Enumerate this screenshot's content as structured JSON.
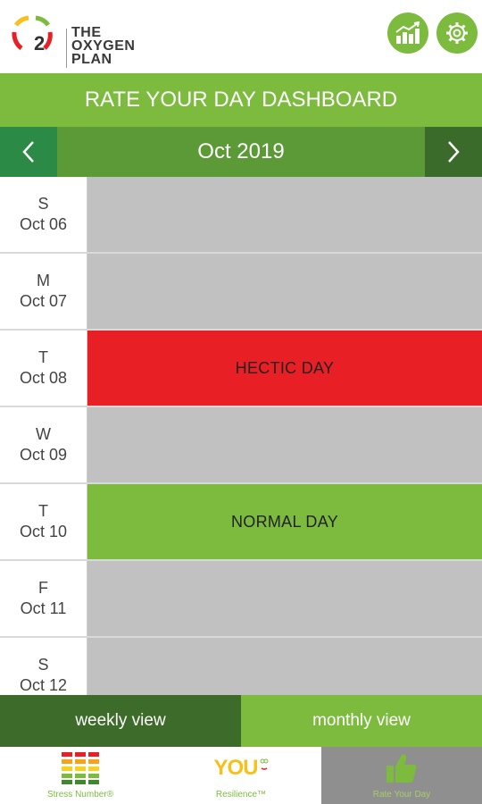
{
  "header": {
    "logo_mark": "2",
    "logo_lines": [
      "THE",
      "OXYGEN",
      "PLAN"
    ],
    "chart_icon": "trending-chart-icon",
    "gear_icon": "gear-icon"
  },
  "title": "RATE YOUR DAY DASHBOARD",
  "month_nav": {
    "label": "Oct 2019",
    "prev_icon": "chevron-left-icon",
    "next_icon": "chevron-right-icon"
  },
  "days": [
    {
      "weekday": "S",
      "date": "Oct 06",
      "rating": "",
      "color": "#c1c1c1"
    },
    {
      "weekday": "M",
      "date": "Oct 07",
      "rating": "",
      "color": "#c1c1c1"
    },
    {
      "weekday": "T",
      "date": "Oct 08",
      "rating": "HECTIC DAY",
      "color": "#e91f26"
    },
    {
      "weekday": "W",
      "date": "Oct 09",
      "rating": "",
      "color": "#c1c1c1"
    },
    {
      "weekday": "T",
      "date": "Oct 10",
      "rating": "NORMAL DAY",
      "color": "#7cbb3e"
    },
    {
      "weekday": "F",
      "date": "Oct 11",
      "rating": "",
      "color": "#c1c1c1"
    },
    {
      "weekday": "S",
      "date": "Oct 12",
      "rating": "",
      "color": "#c1c1c1"
    }
  ],
  "views": {
    "weekly": "weekly view",
    "monthly": "monthly view"
  },
  "tabs": [
    {
      "label": "Stress Number®",
      "icon": "stress-bars-icon"
    },
    {
      "label": "Resilience™",
      "logo": "YOU",
      "icon": "you-logo-icon"
    },
    {
      "label": "Rate Your Day",
      "icon": "thumbs-up-icon"
    }
  ],
  "colors": {
    "brand_green": "#7cbb3e",
    "dark_green": "#3d6b29",
    "hectic_red": "#e91f26",
    "neutral_gray": "#c1c1c1"
  }
}
